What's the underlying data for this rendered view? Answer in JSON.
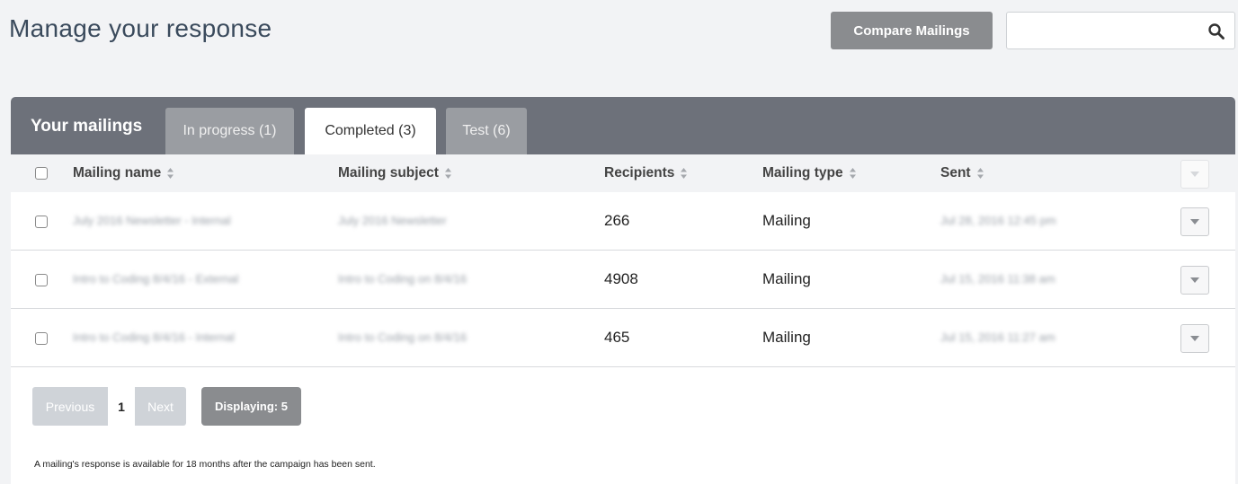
{
  "header": {
    "title": "Manage your response",
    "compare_button": "Compare Mailings",
    "search_placeholder": ""
  },
  "tabs": {
    "title": "Your mailings",
    "items": [
      {
        "label": "In progress (1)",
        "active": false
      },
      {
        "label": "Completed (3)",
        "active": true
      },
      {
        "label": "Test (6)",
        "active": false
      }
    ]
  },
  "table": {
    "columns": [
      "Mailing name",
      "Mailing subject",
      "Recipients",
      "Mailing type",
      "Sent"
    ],
    "rows": [
      {
        "name": "July 2016 Newsletter - Internal",
        "subject": "July 2016 Newsletter",
        "recipients": "266",
        "type": "Mailing",
        "sent": "Jul 28, 2016 12:45 pm"
      },
      {
        "name": "Intro to Coding 8/4/16 - External",
        "subject": "Intro to Coding on 8/4/16",
        "recipients": "4908",
        "type": "Mailing",
        "sent": "Jul 15, 2016 11:38 am"
      },
      {
        "name": "Intro to Coding 8/4/16 - Internal",
        "subject": "Intro to Coding on 8/4/16",
        "recipients": "465",
        "type": "Mailing",
        "sent": "Jul 15, 2016 11:27 am"
      }
    ]
  },
  "pagination": {
    "previous": "Previous",
    "current": "1",
    "next": "Next",
    "displaying": "Displaying: 5"
  },
  "footnote": "A mailing's response is available for 18 months after the campaign has been sent.",
  "colors": {
    "tabbar": "#6d717a",
    "button_gray": "#8a8c8f",
    "title": "#3a4a5c"
  },
  "icons": {
    "search": "search-icon",
    "sort": "sort-icon",
    "dropdown": "chevron-down-icon"
  }
}
